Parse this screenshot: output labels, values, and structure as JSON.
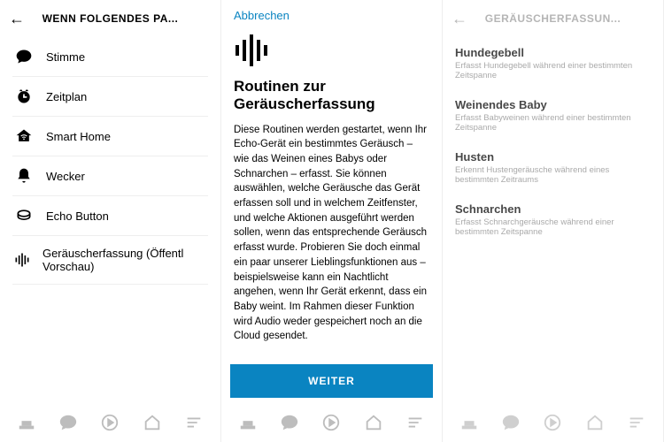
{
  "left": {
    "header_title": "WENN FOLGENDES PA...",
    "items": [
      {
        "label": "Stimme"
      },
      {
        "label": "Zeitplan"
      },
      {
        "label": "Smart Home"
      },
      {
        "label": "Wecker"
      },
      {
        "label": "Echo Button"
      },
      {
        "label": "Geräuscherfassung (Öffentl Vorschau)"
      }
    ]
  },
  "middle": {
    "cancel": "Abbrechen",
    "title": "Routinen zur Geräuscherfassung",
    "body": "Diese Routinen werden gestartet, wenn Ihr Echo-Gerät ein bestimmtes Geräusch – wie das Weinen eines Babys oder Schnarchen – erfasst. Sie können auswählen, welche Geräusche das Gerät erfassen soll und in welchem Zeitfenster, und welche Aktionen ausgeführt werden sollen, wenn das entsprechende Geräusch erfasst wurde. Probieren Sie doch einmal ein paar unserer Lieblingsfunktionen aus – beispielsweise kann ein Nachtlicht angehen, wenn Ihr Gerät erkennt, dass ein Baby weint. Im Rahmen dieser Funktion wird Audio weder gespeichert noch an die Cloud gesendet.",
    "continue": "WEITER"
  },
  "right": {
    "header_title": "GERÄUSCHERFASSUN...",
    "items": [
      {
        "title": "Hundegebell",
        "sub": "Erfasst Hundegebell während einer bestimmten Zeitspanne"
      },
      {
        "title": "Weinendes Baby",
        "sub": "Erfasst Babyweinen während einer bestimmten Zeitspanne"
      },
      {
        "title": "Husten",
        "sub": "Erkennt Hustengeräusche während eines bestimmten Zeitraums"
      },
      {
        "title": "Schnarchen",
        "sub": "Erfasst Schnarchgeräusche während einer bestimmten Zeitspanne"
      }
    ]
  }
}
